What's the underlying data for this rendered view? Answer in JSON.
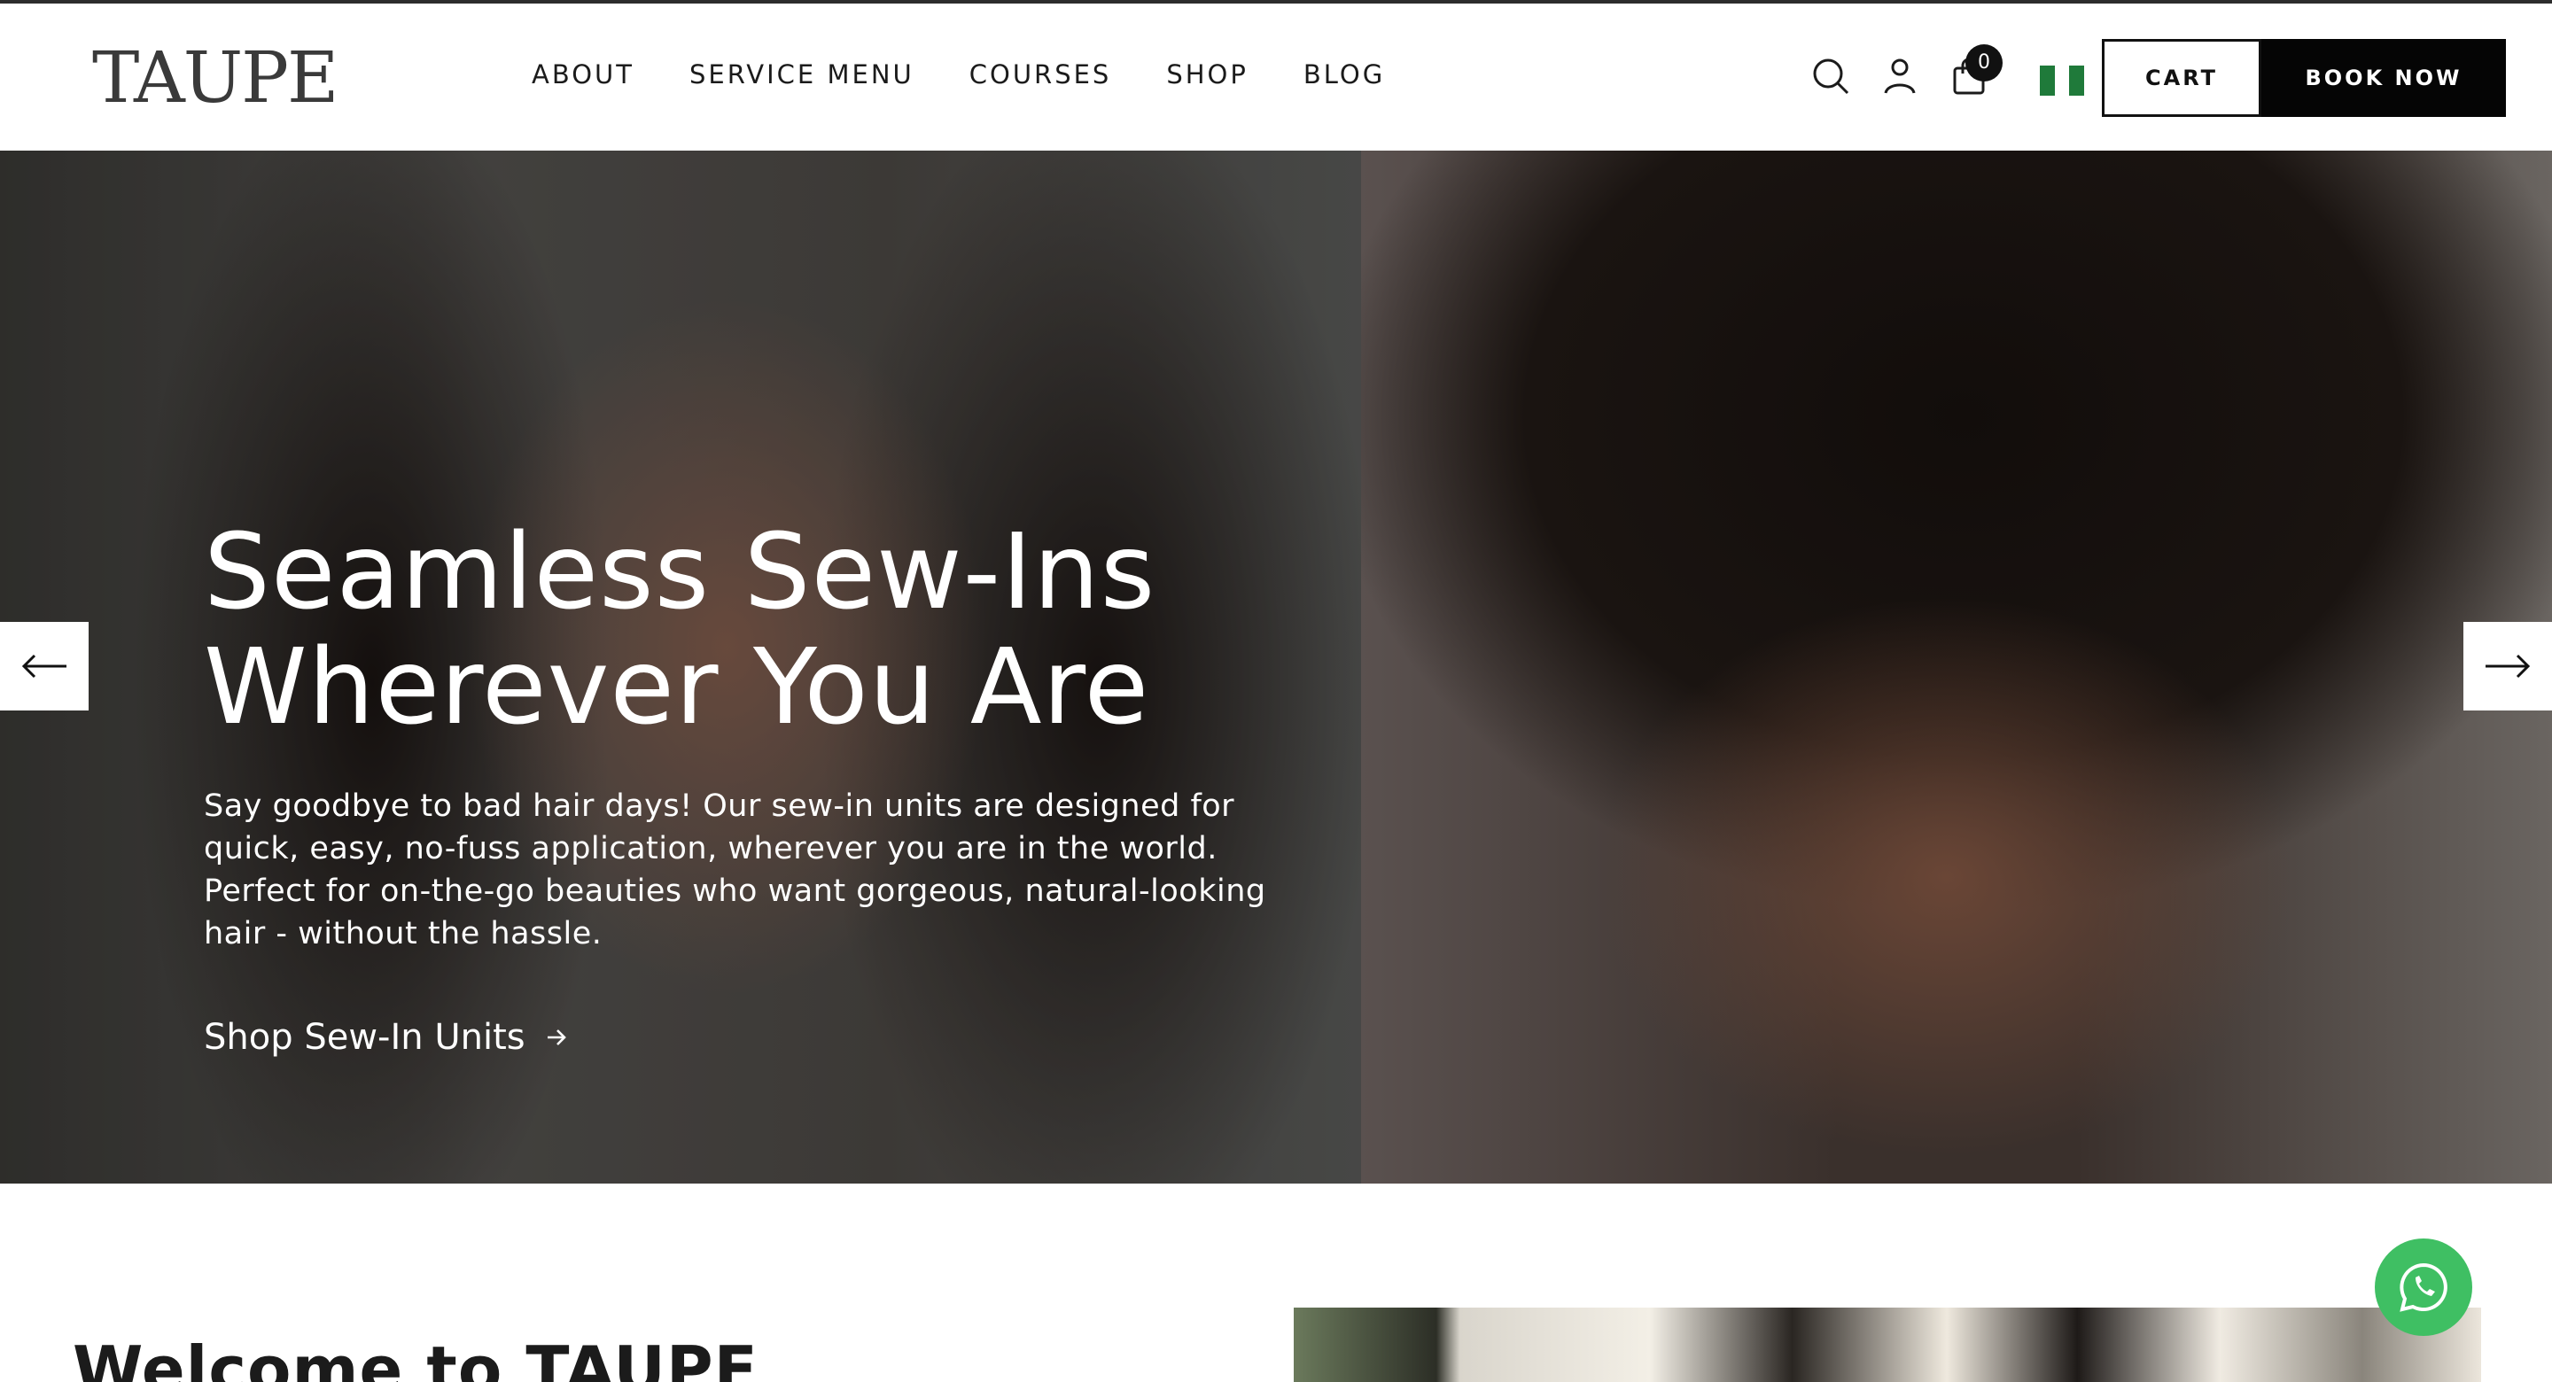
{
  "brand": {
    "logo_text": "TAUPE"
  },
  "nav": {
    "items": [
      {
        "label": "ABOUT"
      },
      {
        "label": "SERVICE MENU"
      },
      {
        "label": "COURSES"
      },
      {
        "label": "SHOP"
      },
      {
        "label": "BLOG"
      }
    ],
    "cart_count": "0",
    "cart_label": "CART",
    "book_label": "BOOK NOW"
  },
  "icons": {
    "search": "search-icon",
    "account": "user-icon",
    "bag": "shopping-bag-icon",
    "flag": "nigeria-flag-icon",
    "prev": "arrow-left-icon",
    "next": "arrow-right-icon",
    "cta": "arrow-right-small-icon",
    "chat": "whatsapp-icon"
  },
  "colors": {
    "flag_green": "#1f7a3a",
    "flag_white": "#ffffff",
    "accent_dark": "#050505",
    "whatsapp_green": "#3fbf63"
  },
  "hero": {
    "title_line1": "Seamless Sew-Ins",
    "title_line2": "Wherever You Are",
    "description": "Say goodbye to bad hair days! Our sew-in units are designed for quick, easy, no-fuss application, wherever you are in the world. Perfect for on-the-go beauties who want gorgeous, natural-looking hair - without the hassle.",
    "cta_label": "Shop Sew-In Units"
  },
  "welcome": {
    "title": "Welcome to TAUPE"
  }
}
